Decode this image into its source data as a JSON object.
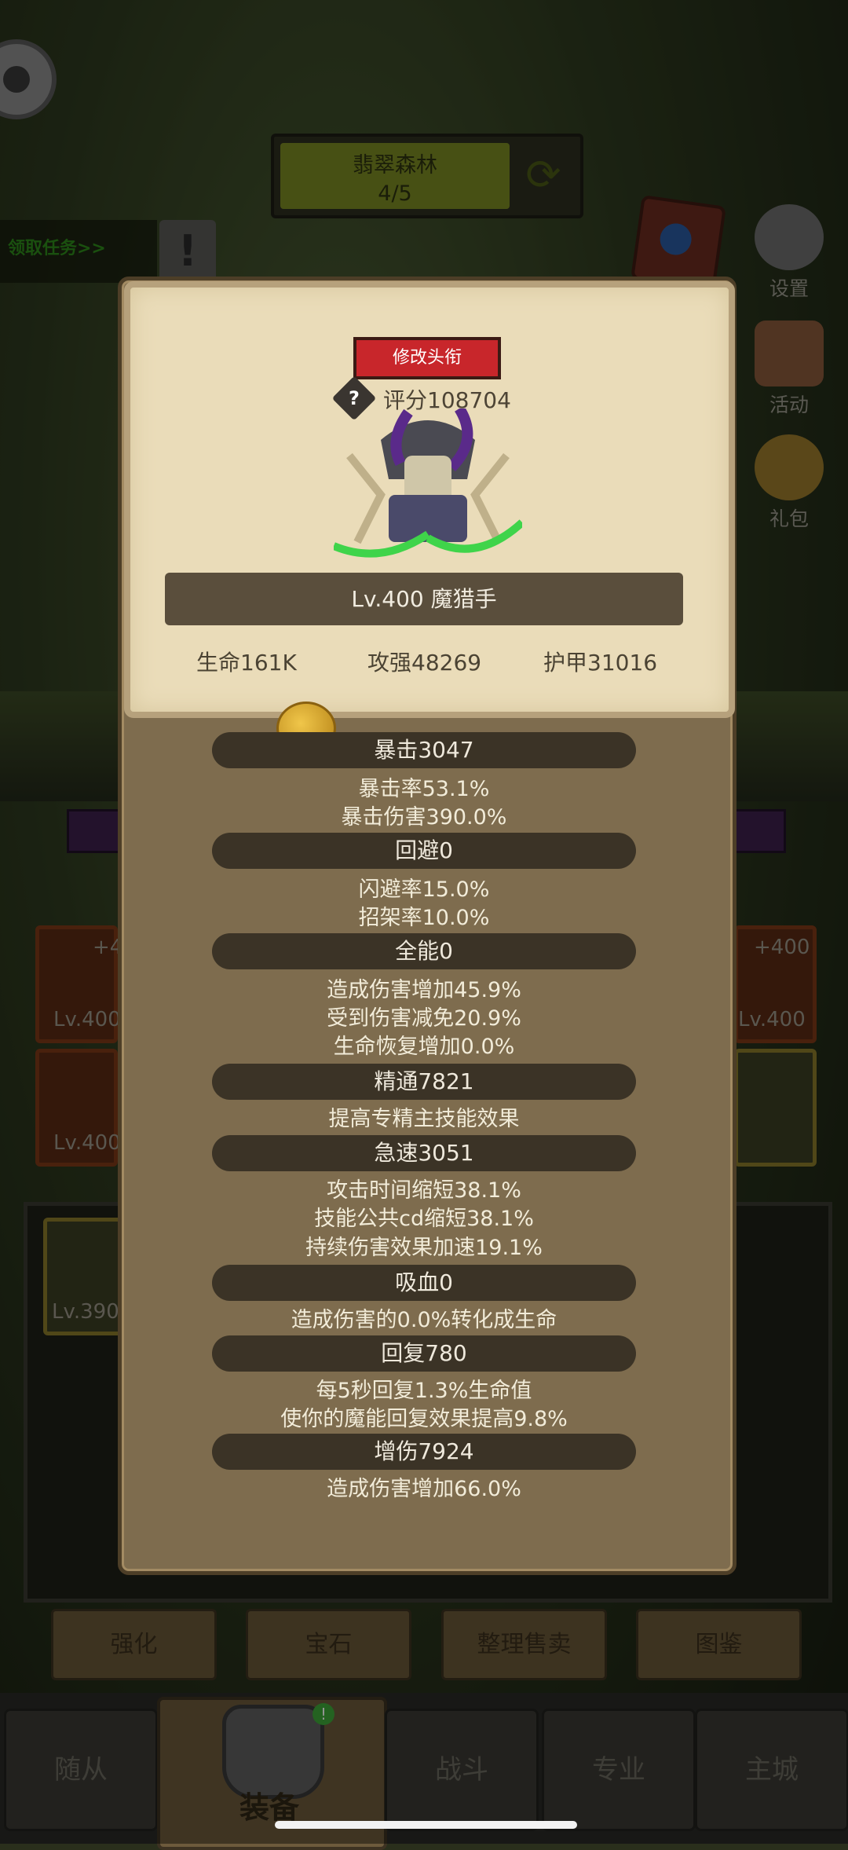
{
  "hud": {
    "stage_name": "翡翠森林",
    "stage_progress": "4/5",
    "quest_label": "领取任务>>",
    "quest_alert": "!"
  },
  "side_menu": [
    {
      "label": "设置",
      "icon": "gear-icon"
    },
    {
      "label": "活动",
      "icon": "scroll-icon"
    },
    {
      "label": "礼包",
      "icon": "gift-bag-icon"
    }
  ],
  "background_slots": [
    {
      "level": "Lv.400",
      "plus": "+4"
    },
    {
      "level": "Lv.400",
      "plus": ""
    },
    {
      "level": "Lv.400",
      "plus": "+400"
    },
    {
      "level": "Lv.390",
      "plus": ""
    }
  ],
  "actions": [
    "强化",
    "宝石",
    "整理售卖",
    "图鉴"
  ],
  "nav": [
    "随从",
    "装备",
    "战斗",
    "专业",
    "主城"
  ],
  "equip_badge": "!",
  "modal": {
    "title_button": "修改头衔",
    "help": "?",
    "score": "评分108704",
    "name": "Lv.400 魔猎手",
    "base_stats": [
      "生命161K",
      "攻强48269",
      "护甲31016"
    ],
    "groups": [
      {
        "header": "暴击3047",
        "lines": [
          "暴击率53.1%",
          "暴击伤害390.0%"
        ]
      },
      {
        "header": "回避0",
        "lines": [
          "闪避率15.0%",
          "招架率10.0%"
        ]
      },
      {
        "header": "全能0",
        "lines": [
          "造成伤害增加45.9%",
          "受到伤害减免20.9%",
          "生命恢复增加0.0%"
        ]
      },
      {
        "header": "精通7821",
        "lines": [
          "提高专精主技能效果"
        ]
      },
      {
        "header": "急速3051",
        "lines": [
          "攻击时间缩短38.1%",
          "技能公共cd缩短38.1%",
          "持续伤害效果加速19.1%"
        ]
      },
      {
        "header": "吸血0",
        "lines": [
          "造成伤害的0.0%转化成生命"
        ]
      },
      {
        "header": "回复780",
        "lines": [
          "每5秒回复1.3%生命值",
          "使你的魔能回复效果提高9.8%"
        ]
      },
      {
        "header": "增伤7924",
        "lines": [
          "造成伤害增加66.0%"
        ]
      }
    ]
  }
}
